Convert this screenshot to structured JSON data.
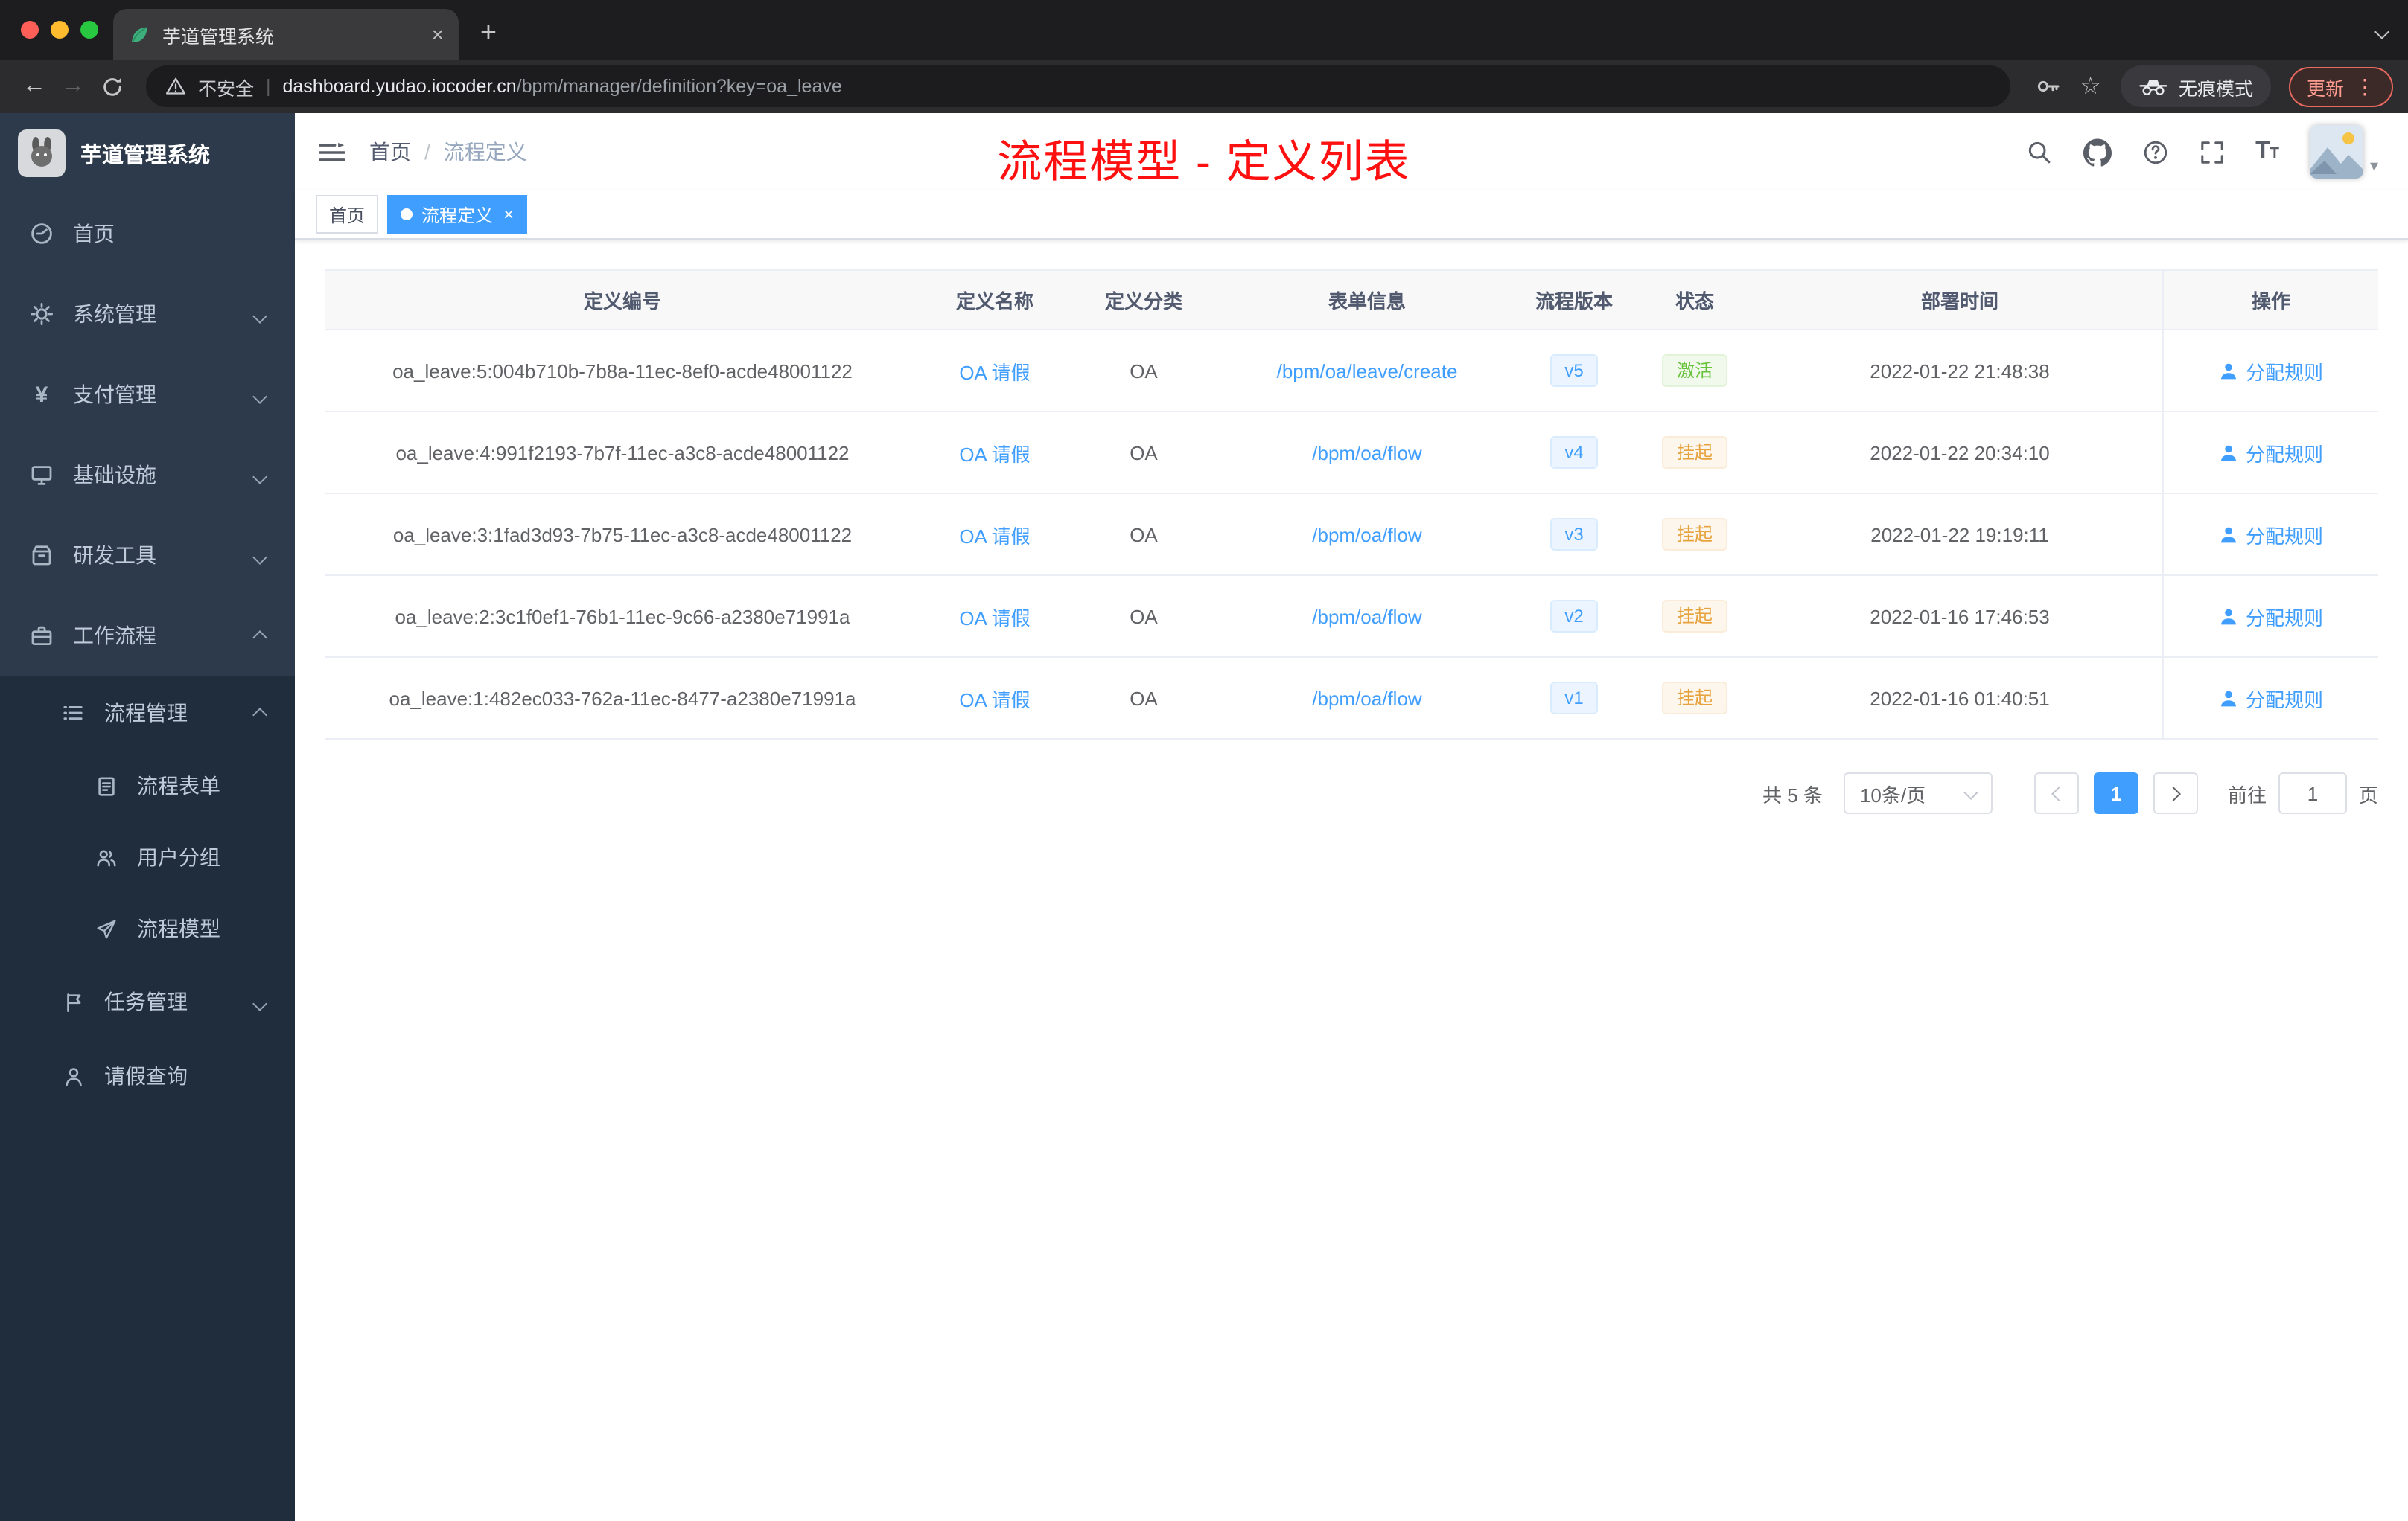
{
  "browser": {
    "tab_title": "芋道管理系统",
    "tab_close": "×",
    "new_tab": "+",
    "back": "←",
    "forward": "→",
    "security_label": "不安全",
    "url_divider": "|",
    "url_domain": "dashboard.yudao.iocoder.cn",
    "url_path": "/bpm/manager/definition?key=oa_leave",
    "star": "☆",
    "incognito_label": "无痕模式",
    "update_label": "更新",
    "menu_dots": "⋮"
  },
  "sidebar": {
    "logo_title": "芋道管理系统",
    "items": [
      {
        "label": "首页"
      },
      {
        "label": "系统管理"
      },
      {
        "label": "支付管理"
      },
      {
        "label": "基础设施"
      },
      {
        "label": "研发工具"
      },
      {
        "label": "工作流程"
      },
      {
        "label": "流程管理"
      },
      {
        "label": "流程表单"
      },
      {
        "label": "用户分组"
      },
      {
        "label": "流程模型"
      },
      {
        "label": "任务管理"
      },
      {
        "label": "请假查询"
      }
    ]
  },
  "header": {
    "breadcrumb": {
      "home": "首页",
      "separator": "/",
      "current": "流程定义"
    },
    "annotation": "流程模型 - 定义列表",
    "avatar_caret": "▾"
  },
  "tags": {
    "home": "首页",
    "active": "流程定义",
    "close": "×"
  },
  "table": {
    "columns": [
      "定义编号",
      "定义名称",
      "定义分类",
      "表单信息",
      "流程版本",
      "状态",
      "部署时间",
      "操作"
    ],
    "rows": [
      {
        "id": "oa_leave:5:004b710b-7b8a-11ec-8ef0-acde48001122",
        "name": "OA 请假",
        "category": "OA",
        "form": "/bpm/oa/leave/create",
        "version": "v5",
        "status": "激活",
        "time": "2022-01-22 21:48:38",
        "action": "分配规则"
      },
      {
        "id": "oa_leave:4:991f2193-7b7f-11ec-a3c8-acde48001122",
        "name": "OA 请假",
        "category": "OA",
        "form": "/bpm/oa/flow",
        "version": "v4",
        "status": "挂起",
        "time": "2022-01-22 20:34:10",
        "action": "分配规则"
      },
      {
        "id": "oa_leave:3:1fad3d93-7b75-11ec-a3c8-acde48001122",
        "name": "OA 请假",
        "category": "OA",
        "form": "/bpm/oa/flow",
        "version": "v3",
        "status": "挂起",
        "time": "2022-01-22 19:19:11",
        "action": "分配规则"
      },
      {
        "id": "oa_leave:2:3c1f0ef1-76b1-11ec-9c66-a2380e71991a",
        "name": "OA 请假",
        "category": "OA",
        "form": "/bpm/oa/flow",
        "version": "v2",
        "status": "挂起",
        "time": "2022-01-16 17:46:53",
        "action": "分配规则"
      },
      {
        "id": "oa_leave:1:482ec033-762a-11ec-8477-a2380e71991a",
        "name": "OA 请假",
        "category": "OA",
        "form": "/bpm/oa/flow",
        "version": "v1",
        "status": "挂起",
        "time": "2022-01-16 01:40:51",
        "action": "分配规则"
      }
    ]
  },
  "pagination": {
    "total": "共 5 条",
    "page_size": "10条/页",
    "current_page": "1",
    "goto_label": "前往",
    "goto_value": "1",
    "page_unit": "页"
  },
  "colors": {
    "accent": "#409eff",
    "status_active": "#67c23a",
    "status_suspended": "#e6a23c",
    "annotation": "#ff0000",
    "sidebar_bg": "#2d3a4b",
    "submenu_bg": "#1f2d3d"
  }
}
